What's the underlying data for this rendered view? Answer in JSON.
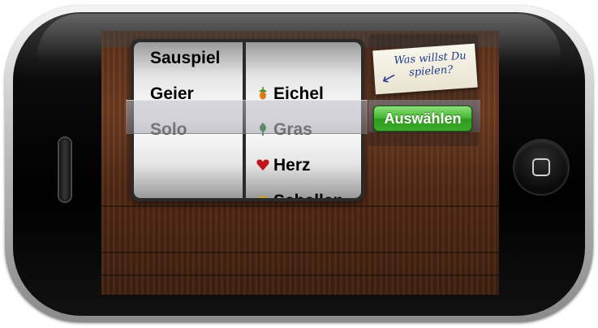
{
  "picker": {
    "game_options": [
      "Sauspiel",
      "Geier",
      "Solo",
      ""
    ],
    "game_selected": "Solo",
    "suit_options": [
      {
        "label": "",
        "icon": "blank"
      },
      {
        "label": "Eichel",
        "icon": "acorn-icon"
      },
      {
        "label": "Gras",
        "icon": "leaf-icon"
      },
      {
        "label": "Herz",
        "icon": "heart-icon"
      },
      {
        "label": "Schellen",
        "icon": "bell-icon"
      }
    ],
    "suit_selected": "Gras"
  },
  "note": {
    "line1": "Was willst Du",
    "line2": "spielen?"
  },
  "button": {
    "label": "Auswählen"
  },
  "colors": {
    "accent_green": "#3aab28",
    "wood": "#5a2f1b",
    "heart": "#c0151a",
    "leaf": "#2f7d3a",
    "acorn_cap": "#3f8f2b",
    "acorn_nut": "#d97d17",
    "bell": "#c9a12a"
  }
}
